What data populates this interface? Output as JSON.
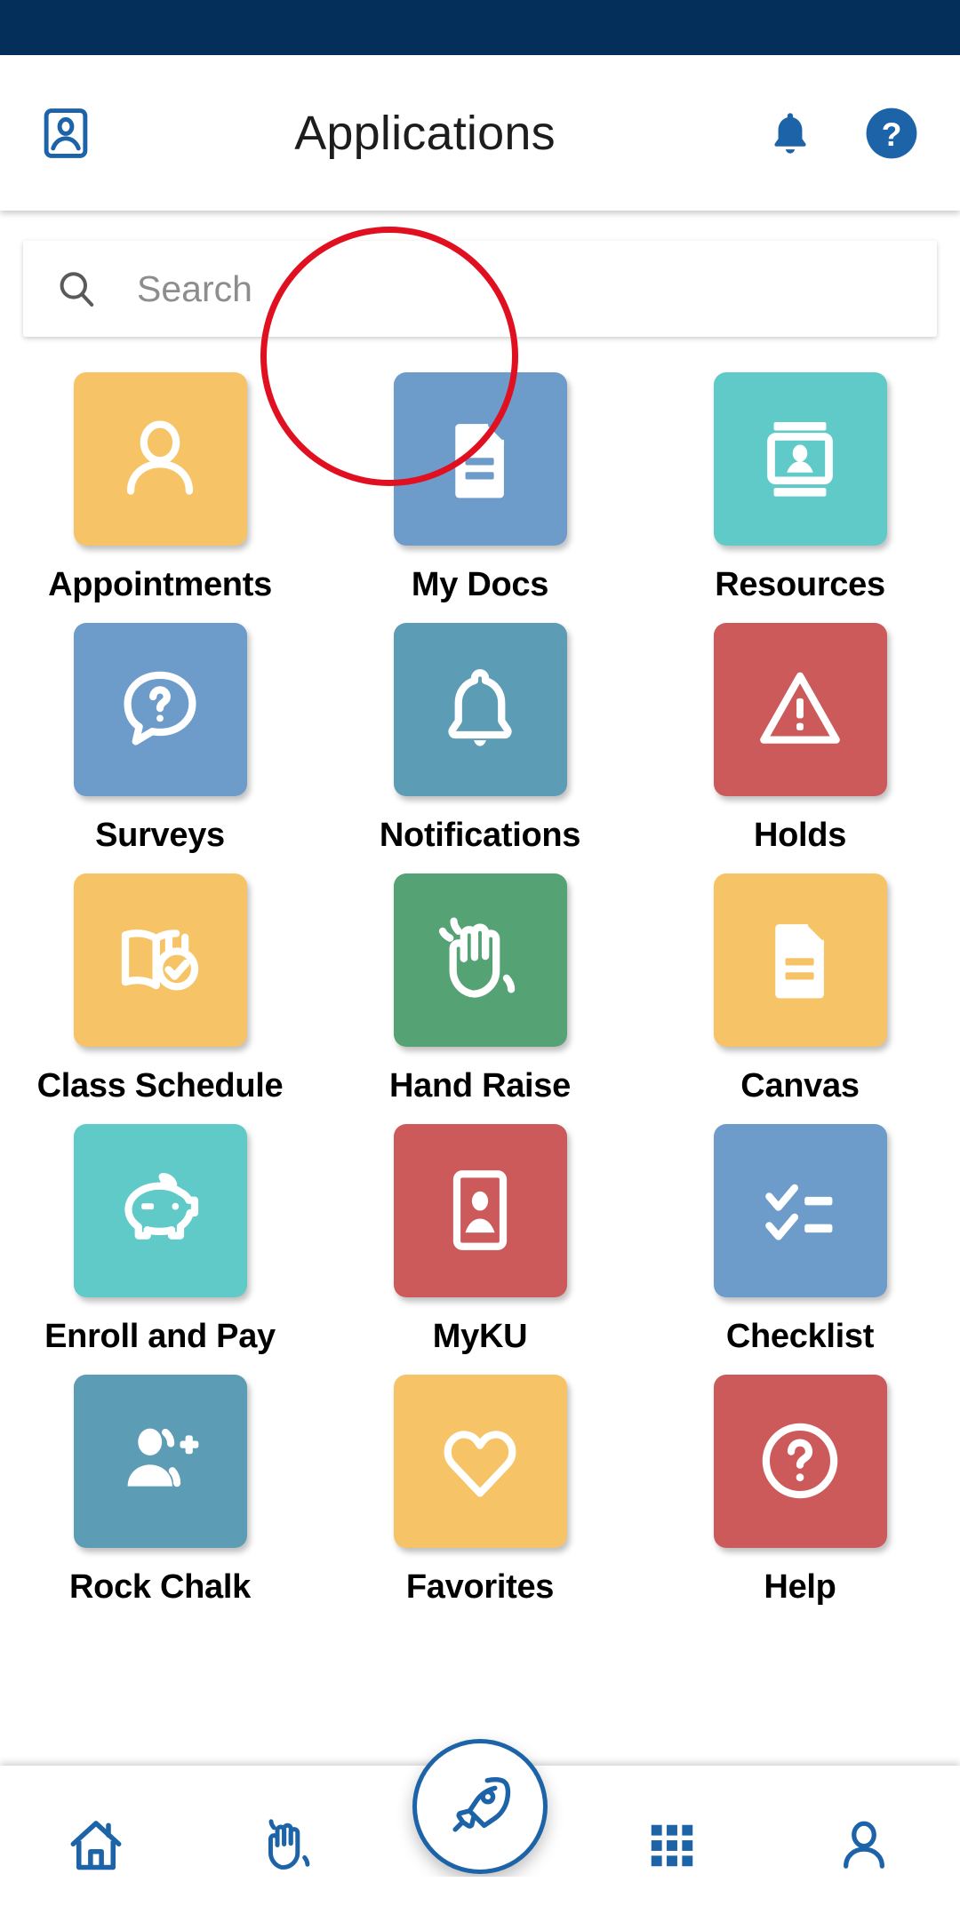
{
  "window": {
    "status_bar_color": "#042f5b",
    "background_color": "#ffffff"
  },
  "header": {
    "title": "Applications",
    "left_icon": "id-card-icon",
    "notification_icon": "bell-icon",
    "help_icon": "help-circle-icon",
    "accent_color": "#1d63a8"
  },
  "search": {
    "placeholder": "Search",
    "value": "",
    "icon": "search-icon"
  },
  "apps": [
    {
      "label": "Appointments",
      "icon": "person-icon",
      "color": "#f6c467"
    },
    {
      "label": "My Docs",
      "icon": "document-icon",
      "color": "#6d9bca"
    },
    {
      "label": "Resources",
      "icon": "id-badge-icon",
      "color": "#5fcac8"
    },
    {
      "label": "Surveys",
      "icon": "question-bubble-icon",
      "color": "#6d9bca"
    },
    {
      "label": "Notifications",
      "icon": "bell-icon",
      "color": "#5d9cb5"
    },
    {
      "label": "Holds",
      "icon": "warning-triangle-icon",
      "color": "#cc5a5a"
    },
    {
      "label": "Class Schedule",
      "icon": "book-clock-icon",
      "color": "#f6c467"
    },
    {
      "label": "Hand Raise",
      "icon": "waving-hand-icon",
      "color": "#55a274"
    },
    {
      "label": "Canvas",
      "icon": "document-icon",
      "color": "#f6c467"
    },
    {
      "label": "Enroll and Pay",
      "icon": "piggy-bank-icon",
      "color": "#5fcac8"
    },
    {
      "label": "MyKU",
      "icon": "id-card-icon",
      "color": "#cc5a5a"
    },
    {
      "label": "Checklist",
      "icon": "checklist-icon",
      "color": "#6d9bca"
    },
    {
      "label": "Rock Chalk",
      "icon": "person-add-icon",
      "color": "#5d9cb5"
    },
    {
      "label": "Favorites",
      "icon": "heart-icon",
      "color": "#f6c467"
    },
    {
      "label": "Help",
      "icon": "question-circle-icon",
      "color": "#cc5a5a"
    }
  ],
  "annotation": {
    "target": "My Docs",
    "shape": "circle",
    "color": "#e01020"
  },
  "bottom_nav": {
    "items": [
      {
        "icon": "home-icon",
        "name": "nav-home"
      },
      {
        "icon": "waving-hand-icon",
        "name": "nav-hand-raise"
      },
      {
        "icon": "rocket-icon",
        "name": "nav-launch"
      },
      {
        "icon": "grid-apps-icon",
        "name": "nav-apps"
      },
      {
        "icon": "person-icon",
        "name": "nav-profile"
      }
    ],
    "accent_color": "#1d63a8"
  }
}
